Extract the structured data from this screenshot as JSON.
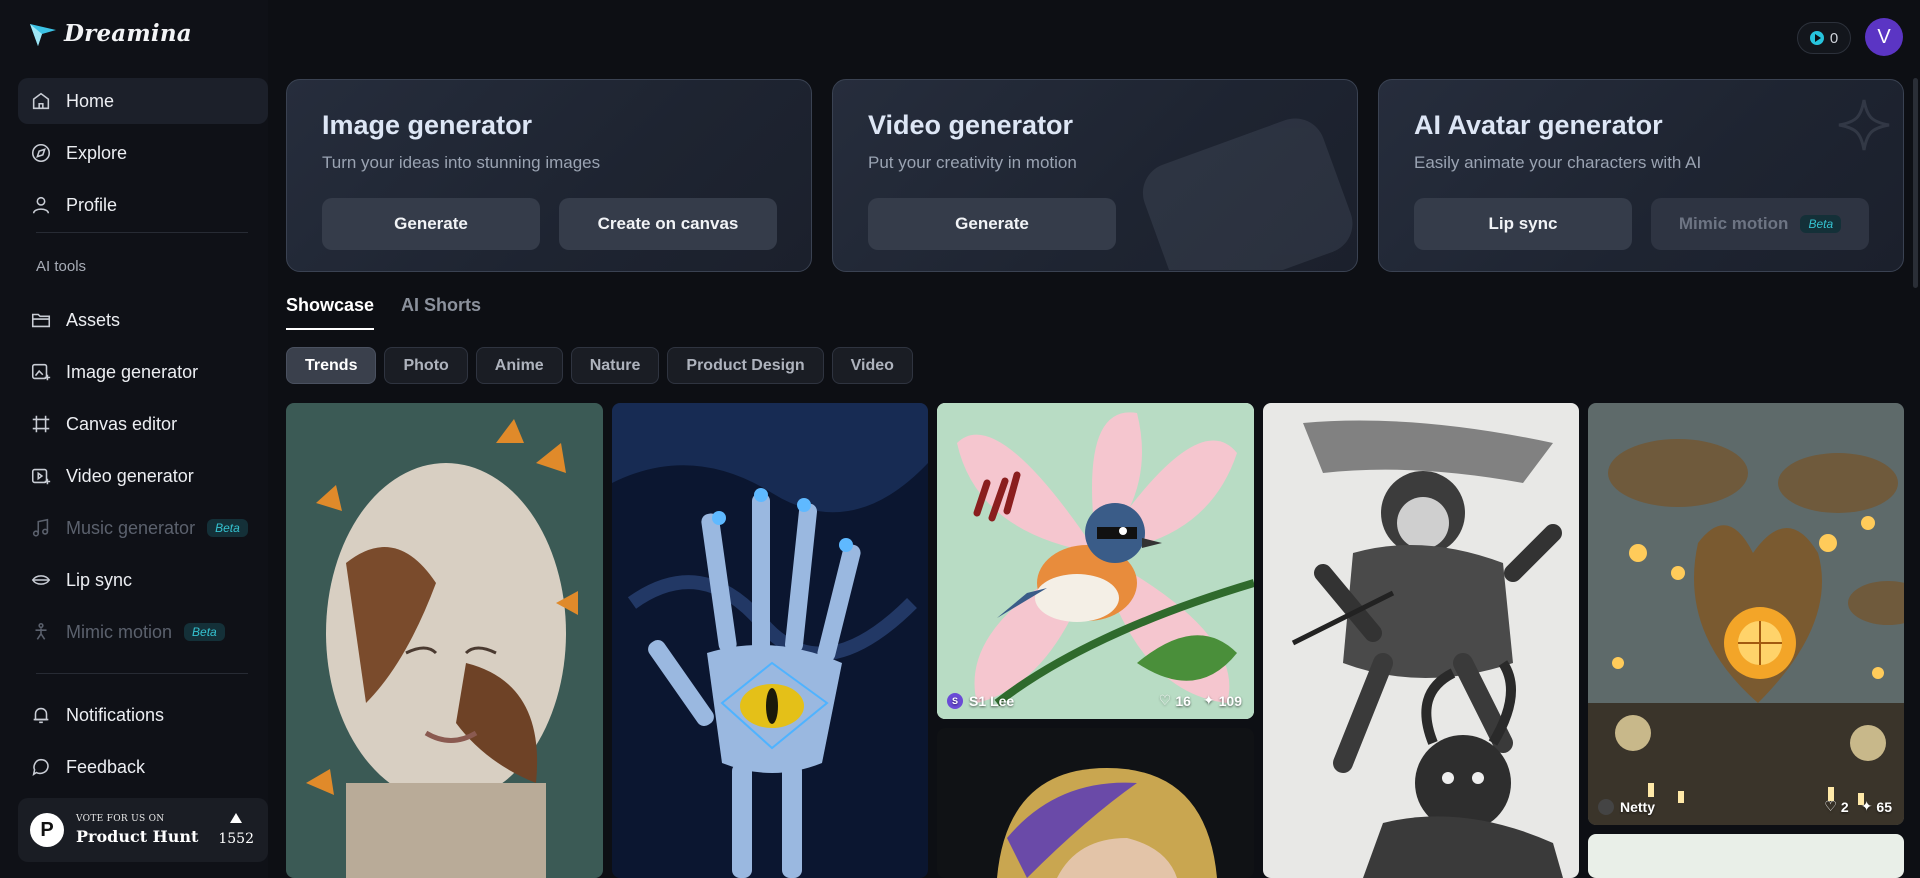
{
  "brand": {
    "name": "Dreamina"
  },
  "sidebar": {
    "main": [
      {
        "label": "Home",
        "icon": "home-icon",
        "active": true
      },
      {
        "label": "Explore",
        "icon": "compass-icon"
      },
      {
        "label": "Profile",
        "icon": "user-icon"
      }
    ],
    "section_label": "AI tools",
    "tools": [
      {
        "label": "Assets",
        "icon": "folder-icon"
      },
      {
        "label": "Image generator",
        "icon": "image-plus-icon"
      },
      {
        "label": "Canvas editor",
        "icon": "canvas-icon"
      },
      {
        "label": "Video generator",
        "icon": "video-plus-icon"
      },
      {
        "label": "Music generator",
        "icon": "music-icon",
        "badge": "Beta",
        "disabled": true
      },
      {
        "label": "Lip sync",
        "icon": "lip-sync-icon"
      },
      {
        "label": "Mimic motion",
        "icon": "mimic-motion-icon",
        "badge": "Beta",
        "disabled": true
      }
    ],
    "bottom": [
      {
        "label": "Notifications",
        "icon": "bell-icon"
      },
      {
        "label": "Feedback",
        "icon": "feedback-icon"
      }
    ],
    "product_hunt": {
      "vote_text": "VOTE FOR US ON",
      "name": "Product Hunt",
      "count": "1552",
      "logo_letter": "P"
    }
  },
  "topbar": {
    "credits": "0",
    "avatar_letter": "V"
  },
  "cards": [
    {
      "title": "Image generator",
      "subtitle": "Turn your ideas into stunning images",
      "buttons": [
        "Generate",
        "Create on canvas"
      ]
    },
    {
      "title": "Video generator",
      "subtitle": "Put your creativity in motion",
      "buttons": [
        "Generate"
      ]
    },
    {
      "title": "AI Avatar generator",
      "subtitle": "Easily animate your characters with AI",
      "buttons": [
        "Lip sync",
        "Mimic motion"
      ],
      "mimic_badge": "Beta"
    }
  ],
  "tabs": [
    "Showcase",
    "AI Shorts"
  ],
  "chips": [
    "Trends",
    "Photo",
    "Anime",
    "Nature",
    "Product Design",
    "Video"
  ],
  "gallery": [
    {
      "subject": "woman with cracked skin and butterflies"
    },
    {
      "subject": "skeleton hand with glowing eye"
    },
    {
      "subject": "bird on lily flower",
      "author": "S1 Lee",
      "author_initial": "S",
      "likes": "16",
      "uses": "109"
    },
    {
      "subject": "monkey warrior ink drawing"
    },
    {
      "subject": "steampunk mechanical heart",
      "author": "Netty",
      "likes": "2",
      "uses": "65"
    },
    {
      "subject": "girl with pearl earring"
    }
  ],
  "colors": {
    "accent_cyan": "#27c4dd",
    "avatar_purple": "#5b35c4",
    "beta_text": "#35c2d0"
  }
}
